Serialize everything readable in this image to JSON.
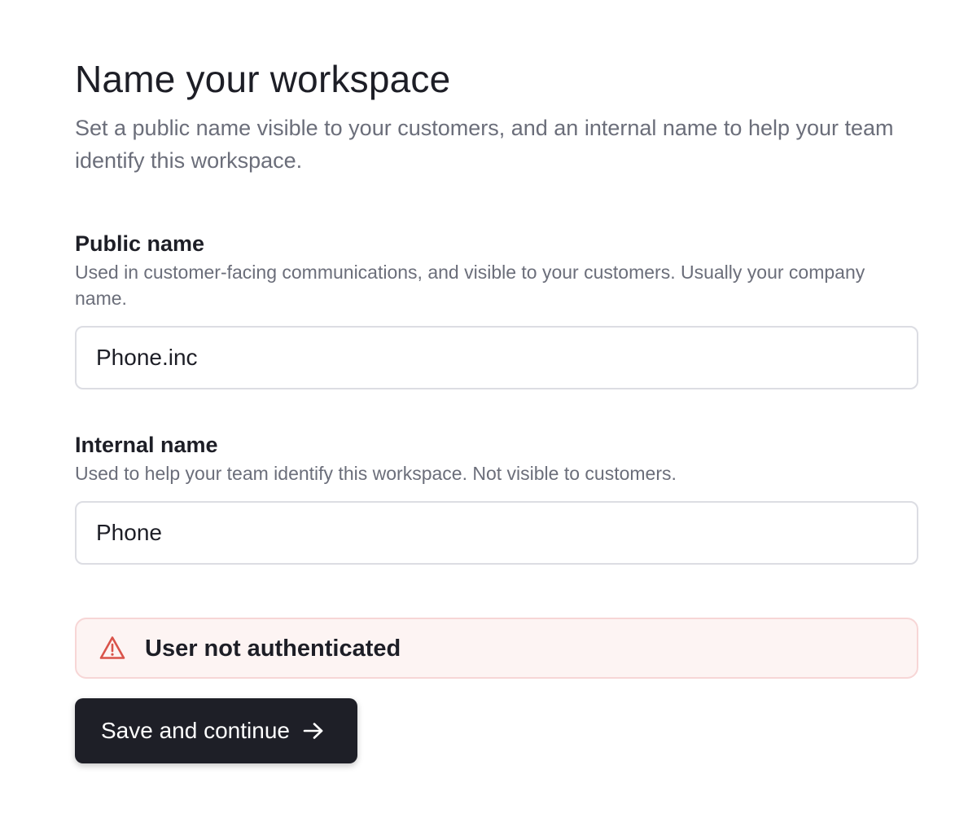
{
  "header": {
    "title": "Name your workspace",
    "subtitle": "Set a public name visible to your customers, and an internal name to help your team identify this workspace."
  },
  "public_name": {
    "label": "Public name",
    "help": "Used in customer-facing communications, and visible to your customers. Usually your company name.",
    "value": "Phone.inc"
  },
  "internal_name": {
    "label": "Internal name",
    "help": "Used to help your team identify this workspace. Not visible to customers.",
    "value": "Phone"
  },
  "alert": {
    "icon": "warning-triangle-icon",
    "message": "User not authenticated",
    "color": "#d9534a"
  },
  "submit": {
    "label": "Save and continue",
    "icon": "arrow-right-icon"
  }
}
